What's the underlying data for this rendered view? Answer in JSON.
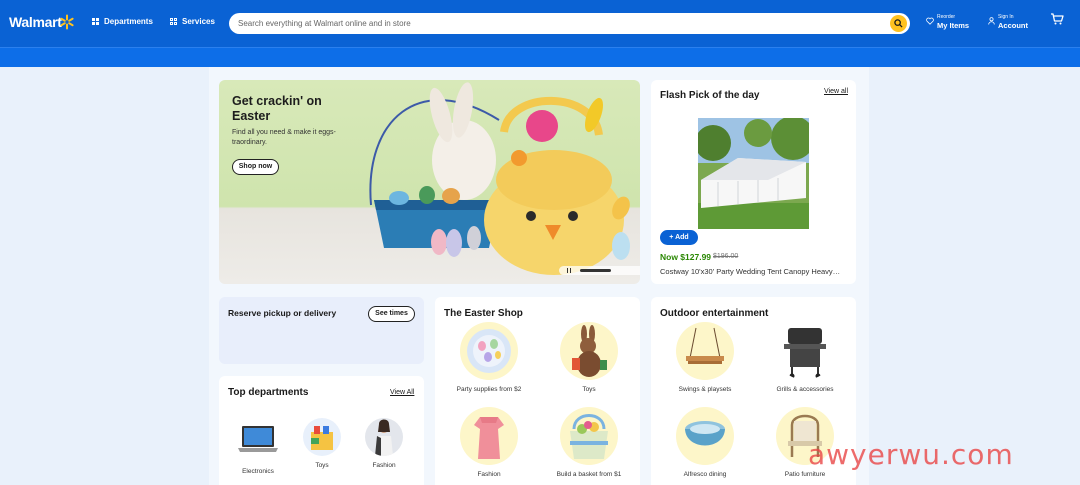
{
  "header": {
    "logo": "Walmart",
    "departments_label": "Departments",
    "services_label": "Services",
    "search_placeholder": "Search everything at Walmart online and in store",
    "reorder_small": "Reorder",
    "reorder_big": "My Items",
    "signin_small": "Sign In",
    "signin_big": "Account",
    "colors": {
      "brand": "#0a62d4",
      "accent": "#ffc220"
    }
  },
  "hero": {
    "title": "Get crackin' on Easter",
    "subtitle": "Find all you need & make it eggs-traordinary.",
    "button": "Shop now"
  },
  "flash": {
    "title": "Flash Pick of the day",
    "view_all": "View all",
    "add_label": "Add",
    "price": "Now $127.99",
    "was_price": "$196.00",
    "product_name": "Costway 10'x30' Party Wedding Tent Canopy Heavy…"
  },
  "reserve": {
    "title": "Reserve pickup or delivery",
    "button": "See times"
  },
  "top_departments": {
    "title": "Top departments",
    "view_all": "View All",
    "items": [
      {
        "label": "Electronics",
        "icon": "laptop-icon"
      },
      {
        "label": "Toys",
        "icon": "toy-blocks-icon"
      },
      {
        "label": "Fashion",
        "icon": "fashion-model-icon"
      }
    ]
  },
  "easter_shop": {
    "title": "The Easter Shop",
    "items": [
      {
        "label": "Party supplies from $2",
        "icon": "easter-plate-icon"
      },
      {
        "label": "Toys",
        "icon": "bunny-toy-icon"
      },
      {
        "label": "Fashion",
        "icon": "pink-dress-icon"
      },
      {
        "label": "Build a basket from $1",
        "icon": "easter-basket-icon"
      }
    ]
  },
  "outdoor": {
    "title": "Outdoor entertainment",
    "items": [
      {
        "label": "Swings & playsets",
        "icon": "swing-icon"
      },
      {
        "label": "Grills & accessories",
        "icon": "grill-icon"
      },
      {
        "label": "Alfresco dining",
        "icon": "bowl-icon"
      },
      {
        "label": "Patio furniture",
        "icon": "patio-chair-icon"
      }
    ]
  },
  "watermark": "awyerwu.com"
}
